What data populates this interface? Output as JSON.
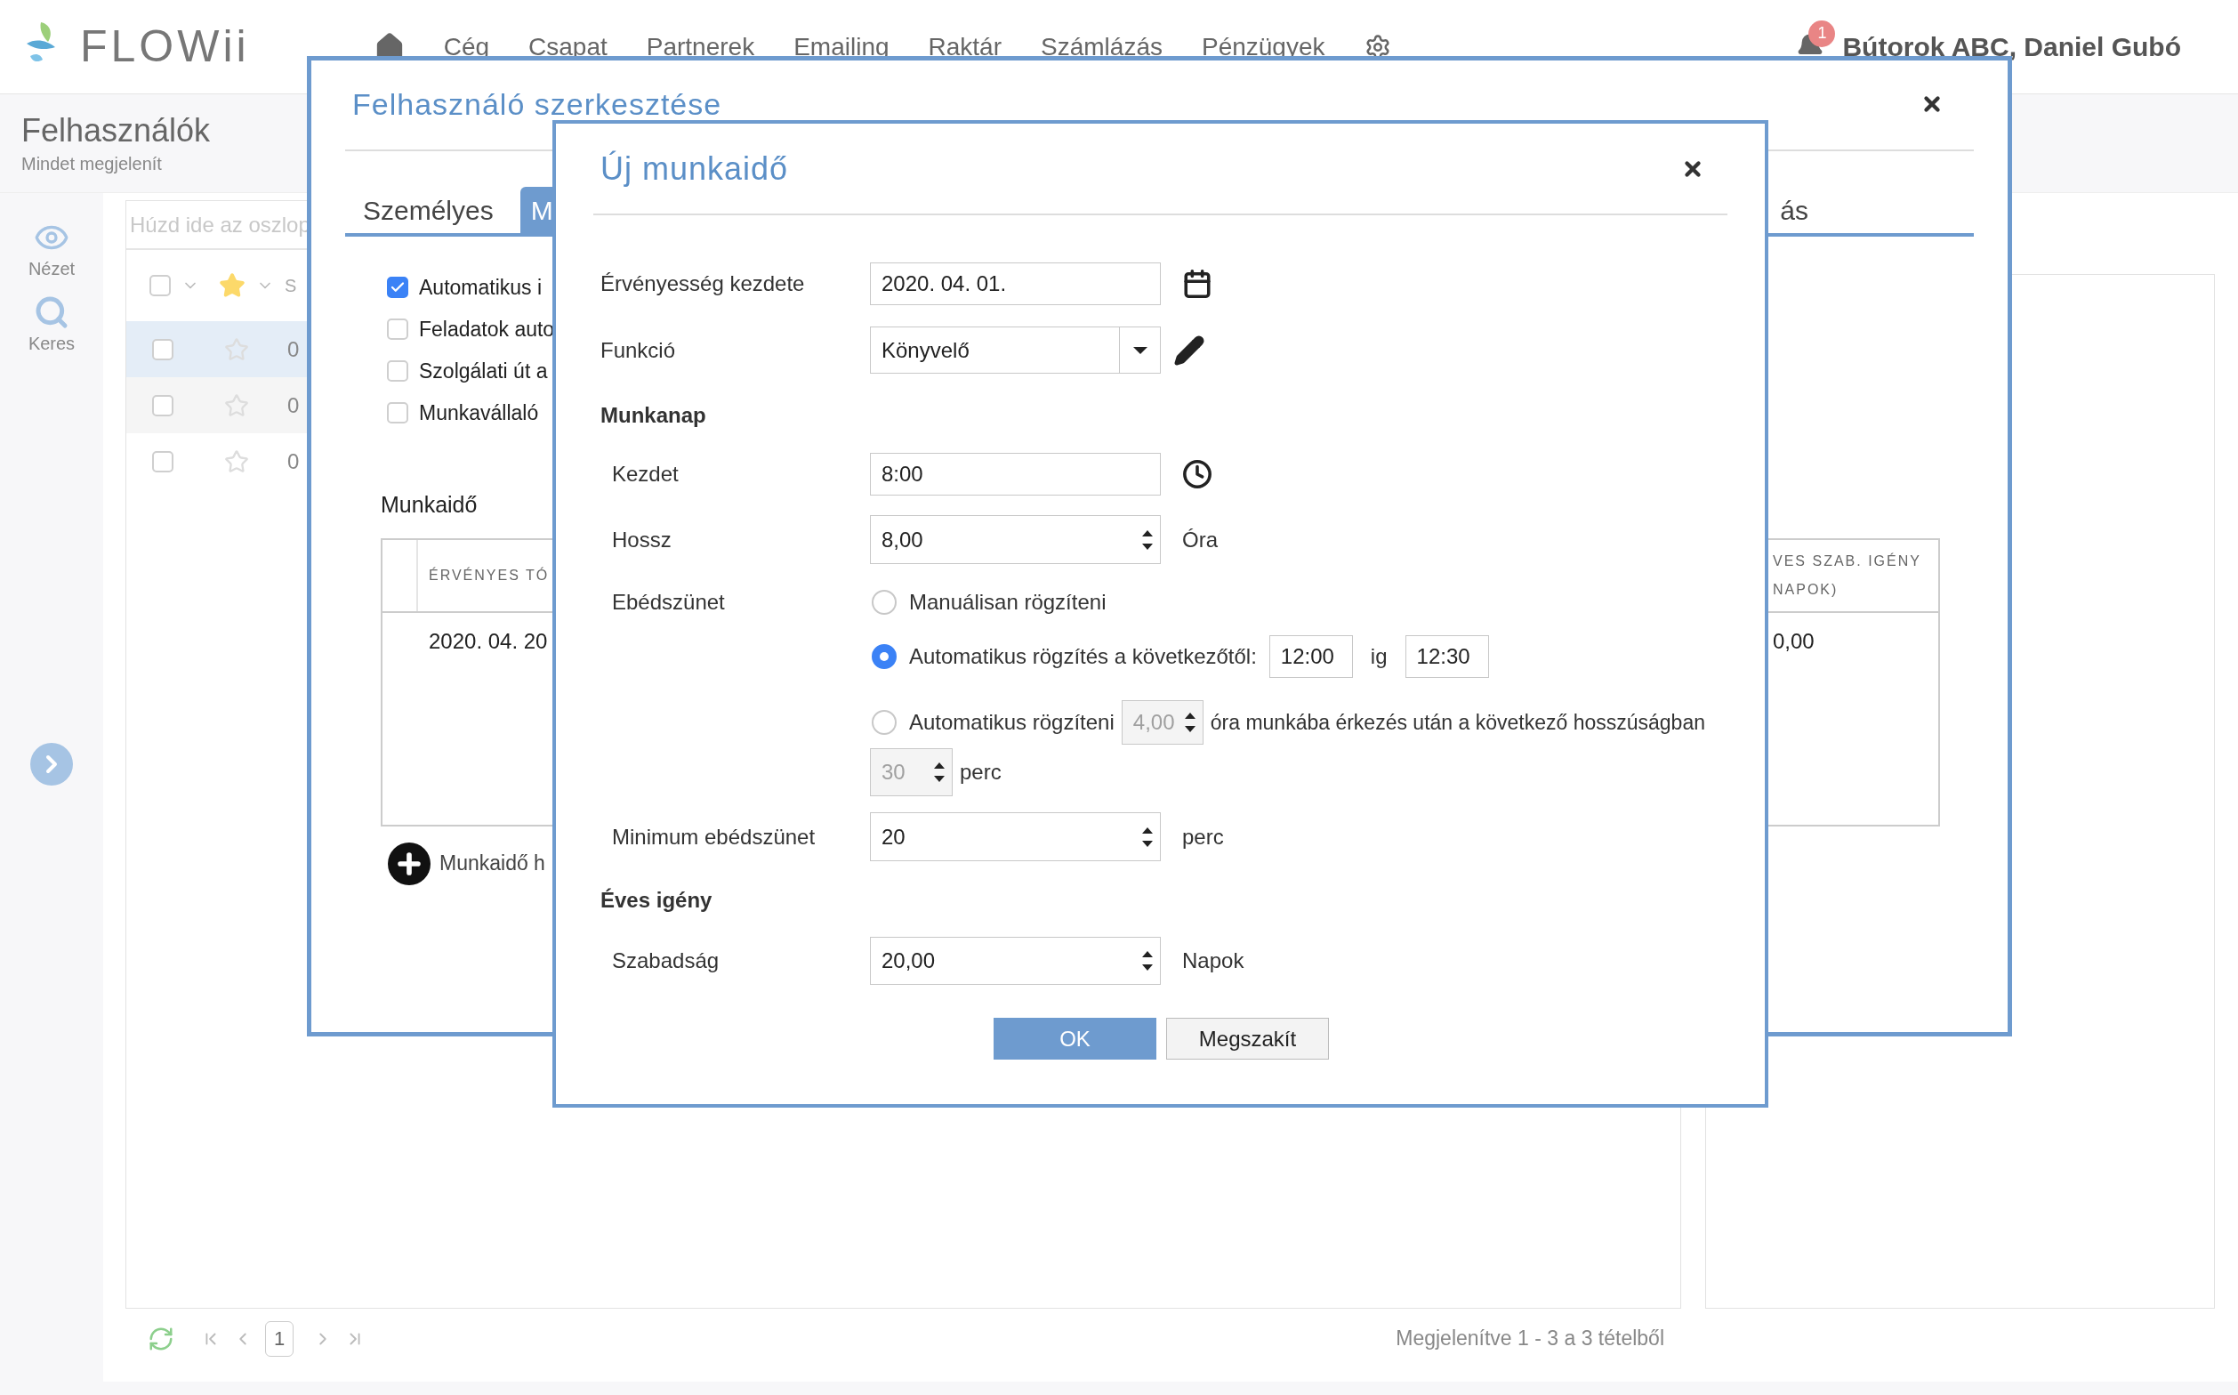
{
  "header": {
    "logo": "FLOWii",
    "nav": [
      "Cég",
      "Csapat",
      "Partnerek",
      "Emailing",
      "Raktár",
      "Számlázás",
      "Pénzügyek"
    ],
    "notifications": "1",
    "user": "Bútorok ABC, Daniel Gubó"
  },
  "page": {
    "title": "Felhasználók",
    "subtitle": "Mindet megjelenít"
  },
  "sidebar": {
    "items": [
      {
        "kind": "view",
        "label": "Nézet"
      },
      {
        "kind": "search",
        "label": "Keres"
      }
    ]
  },
  "grid": {
    "group_hint": "Húzd ide az oszlop",
    "header": {
      "checked": false,
      "column_3": "S"
    },
    "rows": [
      {
        "selected": true,
        "checked": false,
        "starred": false,
        "column_3": "0"
      },
      {
        "selected": false,
        "checked": false,
        "starred": false,
        "column_3": "0"
      },
      {
        "selected": false,
        "checked": false,
        "starred": false,
        "column_3": "0"
      }
    ]
  },
  "pager": {
    "page": "1",
    "summary": "Megjelenítve 1 - 3 a 3 tételből"
  },
  "user_dialog": {
    "title": "Felhasználó szerkesztése",
    "tabs": [
      {
        "label": "Személyes",
        "selected": false
      },
      {
        "label": "M",
        "selected": true
      },
      {
        "label": "ás",
        "selected": false
      }
    ],
    "options": [
      {
        "label": "Automatikus i",
        "checked": true
      },
      {
        "label": "Feladatok auto",
        "checked": false
      },
      {
        "label": "Szolgálati út a",
        "checked": false
      },
      {
        "label": "Munkavállaló",
        "checked": false
      }
    ],
    "worktime_title": "Munkaidő",
    "worktime_table": {
      "columns": [
        "ÉRVÉNYES TÓ",
        "VES SZAB. IGÉNY NAPOK)"
      ],
      "rows": [
        [
          "2020. 04. 20",
          "0,00"
        ]
      ]
    },
    "add_button": "Munkaidő h"
  },
  "work_dialog": {
    "title": "Új munkaidő",
    "valid_from": {
      "label": "Érvényesség kezdete",
      "value": "2020. 04. 01."
    },
    "function": {
      "label": "Funkció",
      "value": "Könyvelő"
    },
    "workday_title": "Munkanap",
    "start": {
      "label": "Kezdet",
      "value": "8:00"
    },
    "length": {
      "label": "Hossz",
      "value": "8,00",
      "unit": "Óra"
    },
    "lunch": {
      "label": "Ebédszünet",
      "options": [
        {
          "kind": "manual",
          "label": "Manuálisan rögzíteni",
          "selected": false
        },
        {
          "kind": "range",
          "label": "Automatikus rögzítés a következőtől:",
          "from": "12:00",
          "to_label": "ig",
          "to": "12:30",
          "selected": true
        },
        {
          "kind": "after",
          "label": "Automatikus rögzíteni",
          "hours": "4,00",
          "suffix": "óra munkába érkezés után a következő hosszúságban",
          "length": "30",
          "unit": "perc",
          "selected": false
        }
      ]
    },
    "min_lunch": {
      "label": "Minimum ebédszünet",
      "value": "20",
      "unit": "perc"
    },
    "yearly_title": "Éves igény",
    "holiday": {
      "label": "Szabadság",
      "value": "20,00",
      "unit": "Napok"
    },
    "buttons": [
      {
        "kind": "primary",
        "label": "OK"
      },
      {
        "kind": "secondary",
        "label": "Megszakít"
      }
    ]
  }
}
